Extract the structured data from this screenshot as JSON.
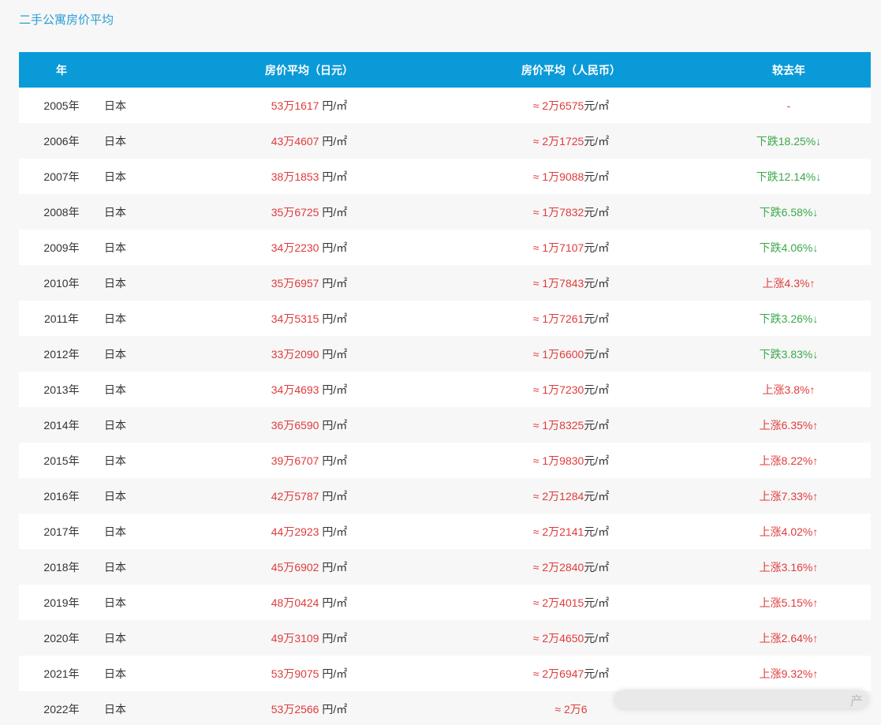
{
  "page_title": "二手公寓房价平均",
  "table": {
    "headers": {
      "year": "年",
      "jpy": "房价平均（日元）",
      "cny": "房价平均（人民币）",
      "change": "较去年"
    },
    "rows": [
      {
        "year": "2005年",
        "country": "日本",
        "jpy": "53万1617",
        "jpy_unit": " 円/㎡",
        "cny": "≈ 2万6575",
        "cny_unit": "元/㎡",
        "change": "-",
        "trend": "none"
      },
      {
        "year": "2006年",
        "country": "日本",
        "jpy": "43万4607",
        "jpy_unit": " 円/㎡",
        "cny": "≈ 2万1725",
        "cny_unit": "元/㎡",
        "change": "下跌18.25%↓",
        "trend": "down"
      },
      {
        "year": "2007年",
        "country": "日本",
        "jpy": "38万1853",
        "jpy_unit": " 円/㎡",
        "cny": "≈ 1万9088",
        "cny_unit": "元/㎡",
        "change": "下跌12.14%↓",
        "trend": "down"
      },
      {
        "year": "2008年",
        "country": "日本",
        "jpy": "35万6725",
        "jpy_unit": " 円/㎡",
        "cny": "≈ 1万7832",
        "cny_unit": "元/㎡",
        "change": "下跌6.58%↓",
        "trend": "down"
      },
      {
        "year": "2009年",
        "country": "日本",
        "jpy": "34万2230",
        "jpy_unit": " 円/㎡",
        "cny": "≈ 1万7107",
        "cny_unit": "元/㎡",
        "change": "下跌4.06%↓",
        "trend": "down"
      },
      {
        "year": "2010年",
        "country": "日本",
        "jpy": "35万6957",
        "jpy_unit": " 円/㎡",
        "cny": "≈ 1万7843",
        "cny_unit": "元/㎡",
        "change": "上涨4.3%↑",
        "trend": "up"
      },
      {
        "year": "2011年",
        "country": "日本",
        "jpy": "34万5315",
        "jpy_unit": " 円/㎡",
        "cny": "≈ 1万7261",
        "cny_unit": "元/㎡",
        "change": "下跌3.26%↓",
        "trend": "down"
      },
      {
        "year": "2012年",
        "country": "日本",
        "jpy": "33万2090",
        "jpy_unit": " 円/㎡",
        "cny": "≈ 1万6600",
        "cny_unit": "元/㎡",
        "change": "下跌3.83%↓",
        "trend": "down"
      },
      {
        "year": "2013年",
        "country": "日本",
        "jpy": "34万4693",
        "jpy_unit": " 円/㎡",
        "cny": "≈ 1万7230",
        "cny_unit": "元/㎡",
        "change": "上涨3.8%↑",
        "trend": "up"
      },
      {
        "year": "2014年",
        "country": "日本",
        "jpy": "36万6590",
        "jpy_unit": " 円/㎡",
        "cny": "≈ 1万8325",
        "cny_unit": "元/㎡",
        "change": "上涨6.35%↑",
        "trend": "up"
      },
      {
        "year": "2015年",
        "country": "日本",
        "jpy": "39万6707",
        "jpy_unit": " 円/㎡",
        "cny": "≈ 1万9830",
        "cny_unit": "元/㎡",
        "change": "上涨8.22%↑",
        "trend": "up"
      },
      {
        "year": "2016年",
        "country": "日本",
        "jpy": "42万5787",
        "jpy_unit": " 円/㎡",
        "cny": "≈ 2万1284",
        "cny_unit": "元/㎡",
        "change": "上涨7.33%↑",
        "trend": "up"
      },
      {
        "year": "2017年",
        "country": "日本",
        "jpy": "44万2923",
        "jpy_unit": " 円/㎡",
        "cny": "≈ 2万2141",
        "cny_unit": "元/㎡",
        "change": "上涨4.02%↑",
        "trend": "up"
      },
      {
        "year": "2018年",
        "country": "日本",
        "jpy": "45万6902",
        "jpy_unit": " 円/㎡",
        "cny": "≈ 2万2840",
        "cny_unit": "元/㎡",
        "change": "上涨3.16%↑",
        "trend": "up"
      },
      {
        "year": "2019年",
        "country": "日本",
        "jpy": "48万0424",
        "jpy_unit": " 円/㎡",
        "cny": "≈ 2万4015",
        "cny_unit": "元/㎡",
        "change": "上涨5.15%↑",
        "trend": "up"
      },
      {
        "year": "2020年",
        "country": "日本",
        "jpy": "49万3109",
        "jpy_unit": " 円/㎡",
        "cny": "≈ 2万4650",
        "cny_unit": "元/㎡",
        "change": "上涨2.64%↑",
        "trend": "up"
      },
      {
        "year": "2021年",
        "country": "日本",
        "jpy": "53万9075",
        "jpy_unit": " 円/㎡",
        "cny": "≈ 2万6947",
        "cny_unit": "元/㎡",
        "change": "上涨9.32%↑",
        "trend": "up"
      },
      {
        "year": "2022年",
        "country": "日本",
        "jpy": "53万2566",
        "jpy_unit": " 円/㎡",
        "cny": "≈ 2万6",
        "cny_unit": "",
        "change": "",
        "trend": "none"
      }
    ]
  },
  "watermark": {
    "text": "产"
  },
  "colors": {
    "header_bg": "#0b9ad8",
    "title": "#2a9fd6",
    "up": "#e03b3b",
    "down": "#3aa84a"
  }
}
